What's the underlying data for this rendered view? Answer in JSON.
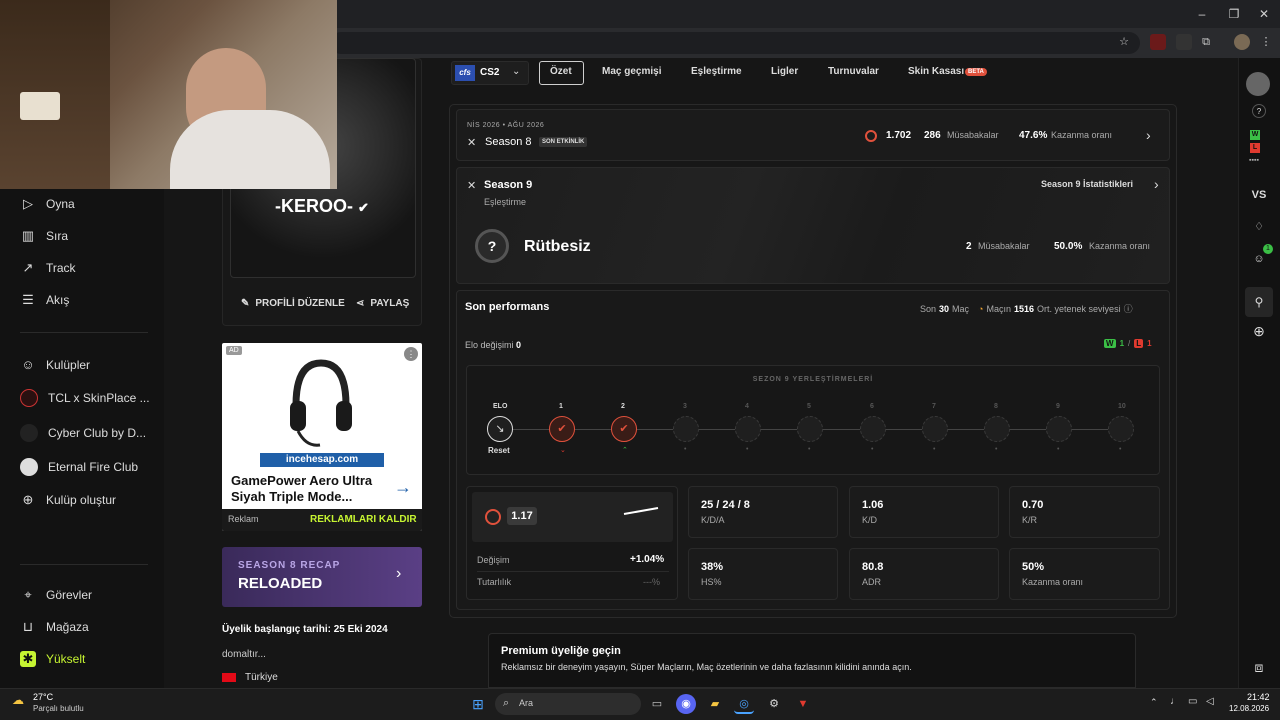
{
  "game": {
    "logo_text": "cfs",
    "name": "CS2"
  },
  "tabs": [
    "Özet",
    "Maç geçmişi",
    "Eşleştirme",
    "Ligler",
    "Turnuvalar",
    "Skin Kasası"
  ],
  "beta_badge": "BETA",
  "sidebar": {
    "items": [
      "Oyna",
      "Sıra",
      "Track",
      "Akış"
    ],
    "clubs_header": "Kulüpler",
    "clubs": [
      "TCL x SkinPlace ...",
      "Cyber Club by D...",
      "Eternal Fire Club"
    ],
    "create_club": "Kulüp oluştur",
    "bottom": [
      "Görevler",
      "Mağaza",
      "Yükselt"
    ]
  },
  "profile": {
    "username": "-KEROO-",
    "edit_label": "PROFİLİ DÜZENLE",
    "share_label": "PAYLAŞ",
    "member_since": "Üyelik başlangıç tarihi: 25 Eki 2024",
    "bio": "domaltır...",
    "country": "Türkiye"
  },
  "ad": {
    "brand_site": "incehesap.com",
    "title": "GamePower Aero Ultra Siyah Triple Mode...",
    "footer_label": "Reklam",
    "remove_label": "REKLAMLARI KALDIR",
    "tag": "AD"
  },
  "recap": {
    "subtitle": "SEASON 8 RECAP",
    "title": "RELOADED"
  },
  "season8": {
    "dates": "NİS 2026 • AĞU 2026",
    "name": "Season 8",
    "badge": "SON ETKİNLİK",
    "elo": "1.702",
    "matches": "286",
    "matches_label": "Müsabakalar",
    "winrate": "47.6%",
    "winrate_label": "Kazanma oranı"
  },
  "season9": {
    "name": "Season 9",
    "mode": "Eşleştirme",
    "stats_link": "Season 9 İstatistikleri",
    "rank": "Rütbesiz",
    "rank_icon": "?",
    "matches": "2",
    "matches_label": "Müsabakalar",
    "winrate": "50.0%",
    "winrate_label": "Kazanma oranı"
  },
  "performance": {
    "title": "Son performans",
    "last_prefix": "Son",
    "last_count": "30",
    "last_suffix": "Maç",
    "skill_prefix": "Maçın",
    "skill_value": "1516",
    "skill_suffix": "Ort. yetenek seviyesi",
    "elo_change_label": "Elo değişimi",
    "elo_change_value": "0",
    "wins": "1",
    "losses": "1",
    "wins_badge": "W",
    "losses_badge": "L",
    "slash": "/",
    "placements_title": "SEZON 9 YERLEŞTİRMELERİ",
    "elo_label": "ELO",
    "reset_label": "Reset",
    "slots": [
      "1",
      "2",
      "3",
      "4",
      "5",
      "6",
      "7",
      "8",
      "9",
      "10"
    ],
    "rating": "1.17",
    "change_label": "Değişim",
    "change_value": "+1.04%",
    "consistency_label": "Tutarlılık",
    "consistency_value": "---%",
    "stats": [
      {
        "value": "25 / 24 / 8",
        "label": "K/D/A"
      },
      {
        "value": "1.06",
        "label": "K/D"
      },
      {
        "value": "0.70",
        "label": "K/R"
      },
      {
        "value": "38%",
        "label": "HS%"
      },
      {
        "value": "80.8",
        "label": "ADR"
      },
      {
        "value": "50%",
        "label": "Kazanma oranı"
      }
    ]
  },
  "premium": {
    "title": "Premium üyeliğe geçin",
    "text": "Reklamsız bir deneyim yaşayın, Süper Maçların, Maç özetlerinin ve daha fazlasının kilidini anında açın."
  },
  "rightbar": {
    "vs": "VS",
    "w": "W",
    "l": "L",
    "badge": "1"
  },
  "taskbar": {
    "temp": "27°C",
    "weather": "Parçalı bulutlu",
    "search": "Ara",
    "time": "21:42",
    "date": "12.08.2026"
  },
  "colors": {
    "accent_green": "#c6f432",
    "loss_red": "#e03a2f",
    "win_green": "#3bbf46",
    "orange": "#e0513c"
  }
}
